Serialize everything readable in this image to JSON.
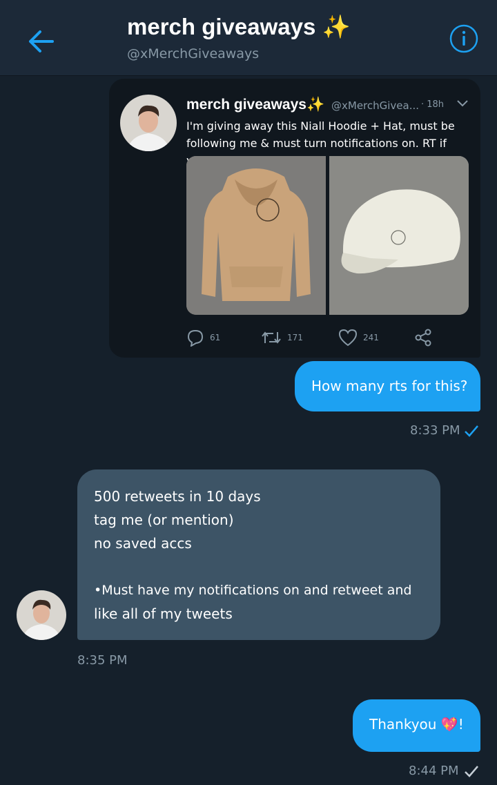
{
  "header": {
    "title": "merch giveaways",
    "title_emoji": "✨",
    "handle": "@xMerchGiveaways"
  },
  "tweet": {
    "name": "merch giveaways",
    "name_emoji": "✨",
    "handle": "@xMerchGivea...",
    "time": "· 18h",
    "text": "I'm giving away this Niall Hoodie + Hat, must be following me & must turn notifications on. RT if you want it!",
    "replies": "61",
    "retweets": "171",
    "likes": "241"
  },
  "messages": [
    {
      "text": "How many rts for this?",
      "time": "8:33 PM"
    },
    {
      "lines": [
        "500 retweets in 10 days",
        "tag me (or mention)",
        "no saved accs",
        "",
        "•Must have my notifications on and retweet and",
        "like all of my tweets"
      ],
      "time": "8:35 PM"
    },
    {
      "text": "Thankyou",
      "emoji": "💖",
      "suffix": "!",
      "time": "8:44 PM"
    }
  ],
  "colors": {
    "background": "#15202b",
    "accent": "#1da1f2",
    "incoming_bubble": "#3d5466",
    "secondary_text": "#8899a6"
  }
}
